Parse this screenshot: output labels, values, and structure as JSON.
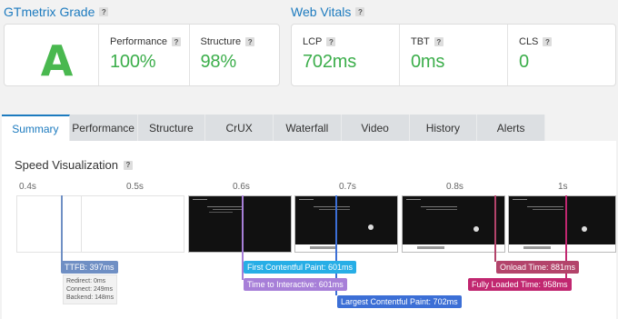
{
  "grade_section": {
    "title": "GTmetrix Grade",
    "help": "?"
  },
  "grade": {
    "letter": "A"
  },
  "metrics": [
    {
      "label": "Performance",
      "value": "100%"
    },
    {
      "label": "Structure",
      "value": "98%"
    }
  ],
  "vitals_section": {
    "title": "Web Vitals",
    "help": "?"
  },
  "vitals": [
    {
      "label": "LCP",
      "value": "702ms"
    },
    {
      "label": "TBT",
      "value": "0ms"
    },
    {
      "label": "CLS",
      "value": "0"
    }
  ],
  "tabs": [
    {
      "label": "Summary",
      "active": true
    },
    {
      "label": "Performance"
    },
    {
      "label": "Structure"
    },
    {
      "label": "CrUX"
    },
    {
      "label": "Waterfall"
    },
    {
      "label": "Video"
    },
    {
      "label": "History"
    },
    {
      "label": "Alerts"
    }
  ],
  "speed": {
    "title": "Speed Visualization",
    "help": "?",
    "ticks": [
      "0.4s",
      "0.5s",
      "0.6s",
      "0.7s",
      "0.8s",
      "1s"
    ],
    "markers": [
      {
        "key": "ttfb",
        "label": "TTFB: 397ms",
        "color": "#6f8fc4"
      },
      {
        "key": "fcp",
        "label": "First Contentful Paint: 601ms",
        "color": "#27aee6"
      },
      {
        "key": "tti",
        "label": "Time to Interactive: 601ms",
        "color": "#a77fd8"
      },
      {
        "key": "lcp",
        "label": "Largest Contentful Paint: 702ms",
        "color": "#3c6fd6"
      },
      {
        "key": "onload",
        "label": "Onload Time: 881ms",
        "color": "#b3446b"
      },
      {
        "key": "fully",
        "label": "Fully Loaded Time: 958ms",
        "color": "#c12770"
      }
    ],
    "ttfb_detail": [
      "Redirect: 0ms",
      "Connect: 249ms",
      "Backend: 148ms"
    ]
  }
}
